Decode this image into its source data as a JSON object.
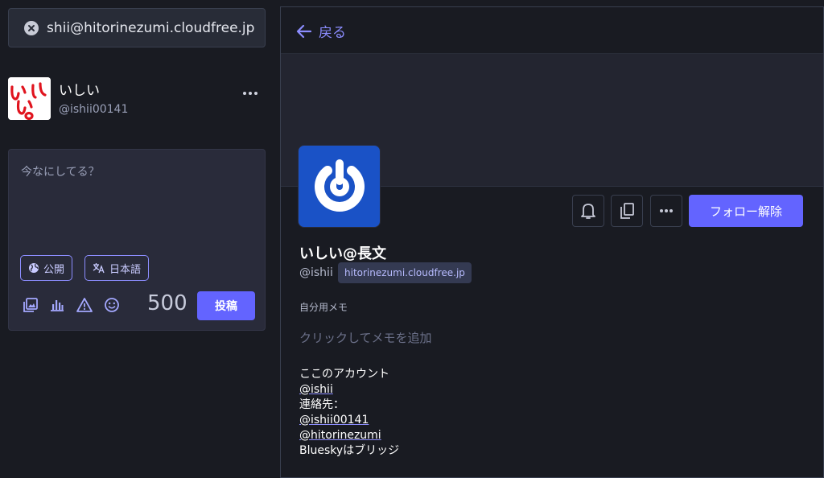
{
  "search": {
    "value": "shii@hitorinezumi.cloudfree.jp"
  },
  "me": {
    "name": "いしい",
    "handle": "@ishii00141",
    "avatar_text": "いしい"
  },
  "composer": {
    "placeholder": "今なにしてる？",
    "visibility_label": "公開",
    "language_label": "日本語",
    "counter": "500",
    "post_label": "投稿"
  },
  "profile": {
    "back_label": "戻る",
    "unfollow_label": "フォロー解除",
    "display_name": "いしい@長文",
    "acct": "@ishii",
    "domain": "hitorinezumi.cloudfree.jp",
    "note_label": "自分用メモ",
    "note_placeholder": "クリックしてメモを追加",
    "bio": {
      "line1": "ここのアカウント",
      "link1": "@ishii",
      "line3": "連絡先：",
      "link2": "@ishii00141",
      "link3": "@hitorinezumi",
      "line6": "Blueskyはブリッジ"
    }
  },
  "colors": {
    "accent": "#6364ff",
    "link": "#8c8dff",
    "background": "#191b22",
    "panel": "#282c37"
  },
  "icons": [
    "close-icon",
    "more-icon",
    "globe-icon",
    "translate-icon",
    "media-icon",
    "poll-icon",
    "warning-icon",
    "emoji-icon",
    "arrow-left-icon",
    "bell-icon",
    "copy-icon",
    "power-logo-icon"
  ]
}
